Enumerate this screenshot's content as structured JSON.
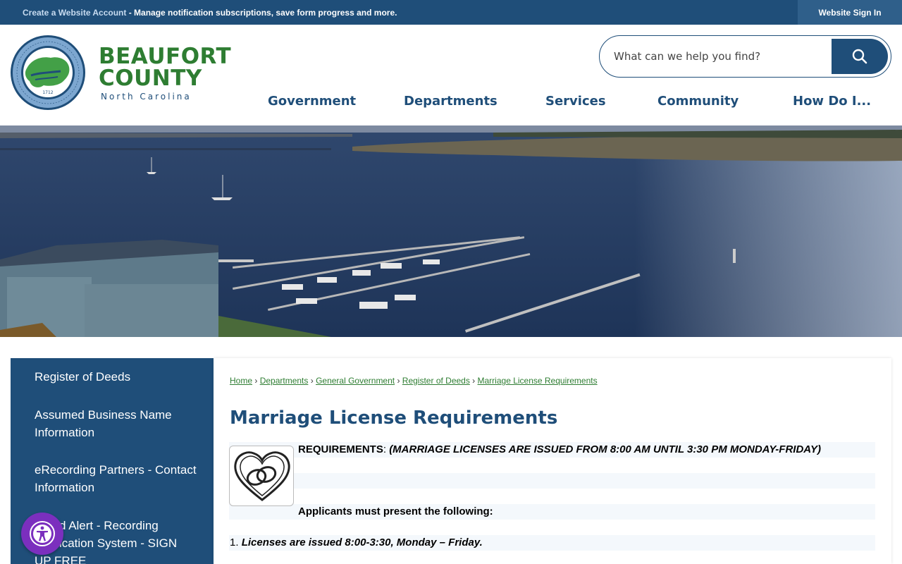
{
  "topbar": {
    "create_link": "Create a Website Account",
    "create_desc": " - Manage notification subscriptions, save form progress and more.",
    "signin": "Website Sign In"
  },
  "brand": {
    "line1": "BEAUFORT",
    "line2": "COUNTY",
    "line3": "North Carolina",
    "seal_year": "1712"
  },
  "search": {
    "placeholder": "What can we help you find?"
  },
  "nav": [
    "Government",
    "Departments",
    "Services",
    "Community",
    "How Do I..."
  ],
  "sidebar": {
    "items": [
      "Register of Deeds",
      "Assumed Business Name Information",
      "eRecording Partners - Contact Information",
      "Fraud Alert - Recording Notification System - SIGN UP FREE"
    ]
  },
  "breadcrumb": [
    "Home",
    "Departments",
    "General Government",
    "Register of Deeds",
    "Marriage License Requirements"
  ],
  "page": {
    "title": "Marriage License Requirements",
    "req_label": "REQUIREMENTS",
    "req_colon": ": ",
    "req_note": "(MARRIAGE LICENSES ARE ISSUED FROM 8:00 AM UNTIL 3:30 PM MONDAY-FRIDAY)",
    "applicants": "Applicants must present the following:",
    "item1_num": "1. ",
    "item1_text": "Licenses are issued 8:00-3:30, Monday – Friday."
  },
  "colors": {
    "navy": "#1f4e79",
    "green": "#2e7d32",
    "accessibility": "#7b2fbe"
  }
}
